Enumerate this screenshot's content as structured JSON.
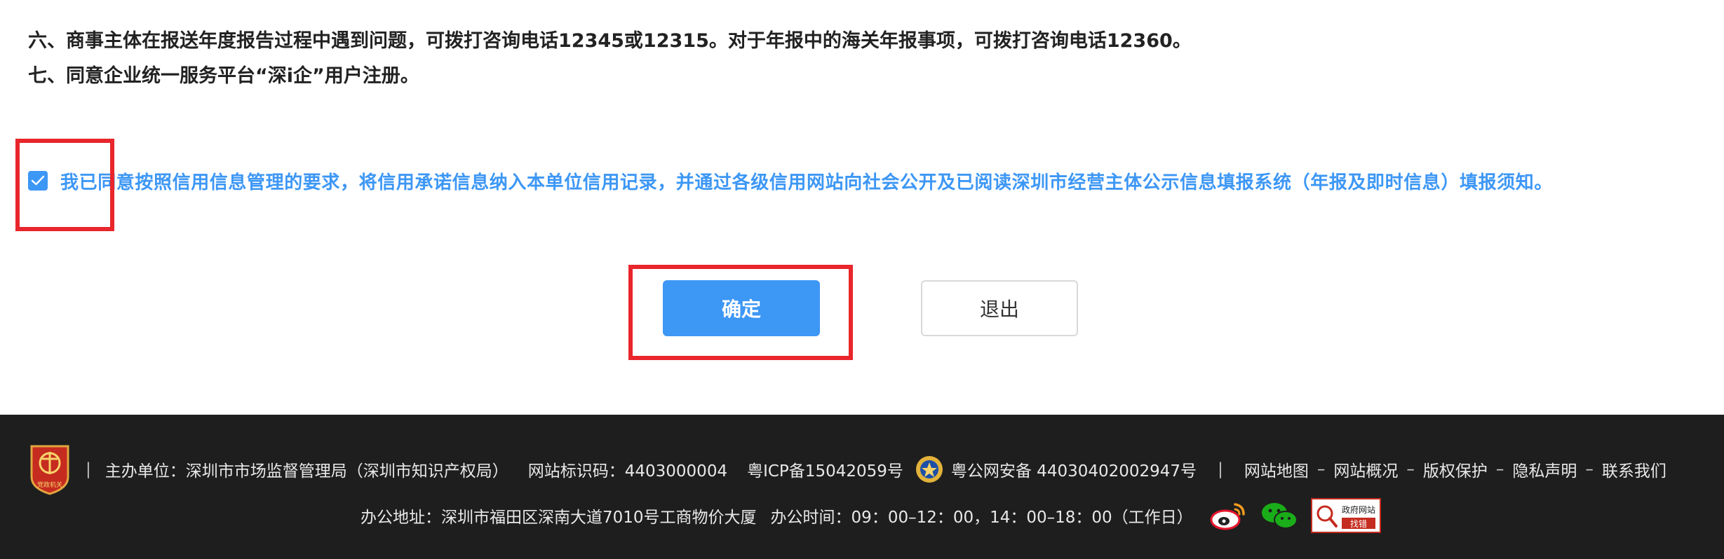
{
  "notices": {
    "line6": "六、商事主体在报送年度报告过程中遇到问题，可拨打咨询电话12345或12315。对于年报中的海关年报事项，可拨打咨询电话12360。",
    "line7": "七、同意企业统一服务平台“深i企”用户注册。"
  },
  "agreement": {
    "checked": true,
    "text": "我已同意按照信用信息管理的要求，将信用承诺信息纳入本单位信用记录，并通过各级信用网站向社会公开及已阅读深圳市经营主体公示信息填报系统（年报及即时信息）填报须知。"
  },
  "buttons": {
    "confirm": "确定",
    "exit": "退出"
  },
  "footer": {
    "logo_text": "党政机关",
    "sponsor": "主办单位：深圳市市场监督管理局（深圳市知识产权局）",
    "site_id": "网站标识码：4403000004",
    "icp": "粤ICP备15042059号",
    "police_record": "粤公网安备 44030402002947号",
    "links": [
      "网站地图",
      "网站概况",
      "版权保护",
      "隐私声明",
      "联系我们"
    ],
    "address": "办公地址：深圳市福田区深南大道7010号工商物价大厦",
    "hours": "办公时间：09：00–12：00，14：00–18：00（工作日）",
    "badge_top": "政府网站",
    "badge_bottom": "找错"
  },
  "colors": {
    "accent": "#3d97f5",
    "highlight": "#e8262b",
    "footer_bg": "#1e1e1e"
  },
  "icons": [
    "check-icon",
    "party-emblem-icon",
    "police-emblem-icon",
    "weibo-icon",
    "wechat-icon",
    "gov-site-error-badge-icon"
  ]
}
